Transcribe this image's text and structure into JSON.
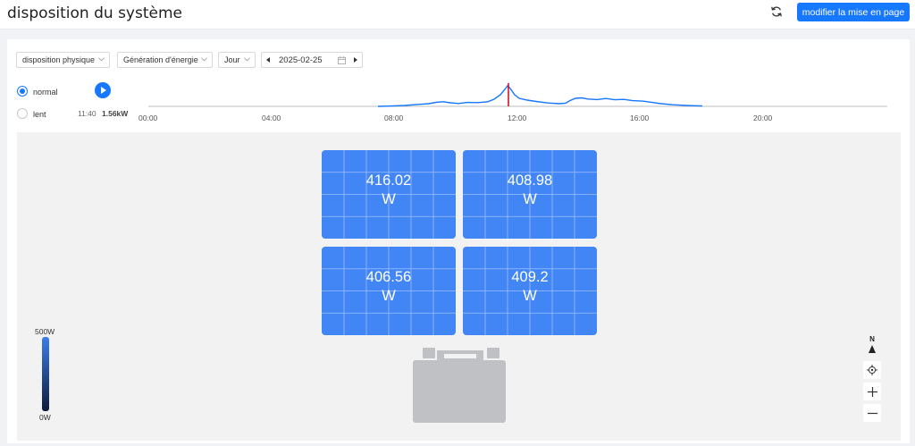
{
  "header": {
    "title": "disposition du système",
    "refresh_icon": "refresh-icon",
    "edit_button": "modifier la mise en page"
  },
  "filters": {
    "layout_select": "disposition physique",
    "metric_select": "Génération d'énergie",
    "period_select": "Jour",
    "date": "2025-02-25"
  },
  "playback": {
    "options": [
      {
        "label": "normal",
        "checked": true
      },
      {
        "label": "lent",
        "checked": false
      }
    ],
    "current_time": "11:40",
    "current_power": "1.56kW"
  },
  "timeline": {
    "ticks": [
      "00:00",
      "04:00",
      "08:00",
      "12:00",
      "16:00",
      "20:00"
    ],
    "line_color": "#1677ff",
    "cursor_color": "#d9001b"
  },
  "panels": [
    {
      "value": "416.02",
      "unit": "W"
    },
    {
      "value": "408.98",
      "unit": "W"
    },
    {
      "value": "406.56",
      "unit": "W"
    },
    {
      "value": "409.2",
      "unit": "W"
    }
  ],
  "legend": {
    "max": "500W",
    "min": "0W"
  },
  "map_controls": {
    "compass_label": "N",
    "icons": [
      "compass-icon",
      "locate-icon",
      "zoom-in-icon",
      "zoom-out-icon"
    ]
  },
  "colors": {
    "accent": "#1677ff",
    "panel": "#4285f4",
    "inverter": "#c0c1c5"
  }
}
